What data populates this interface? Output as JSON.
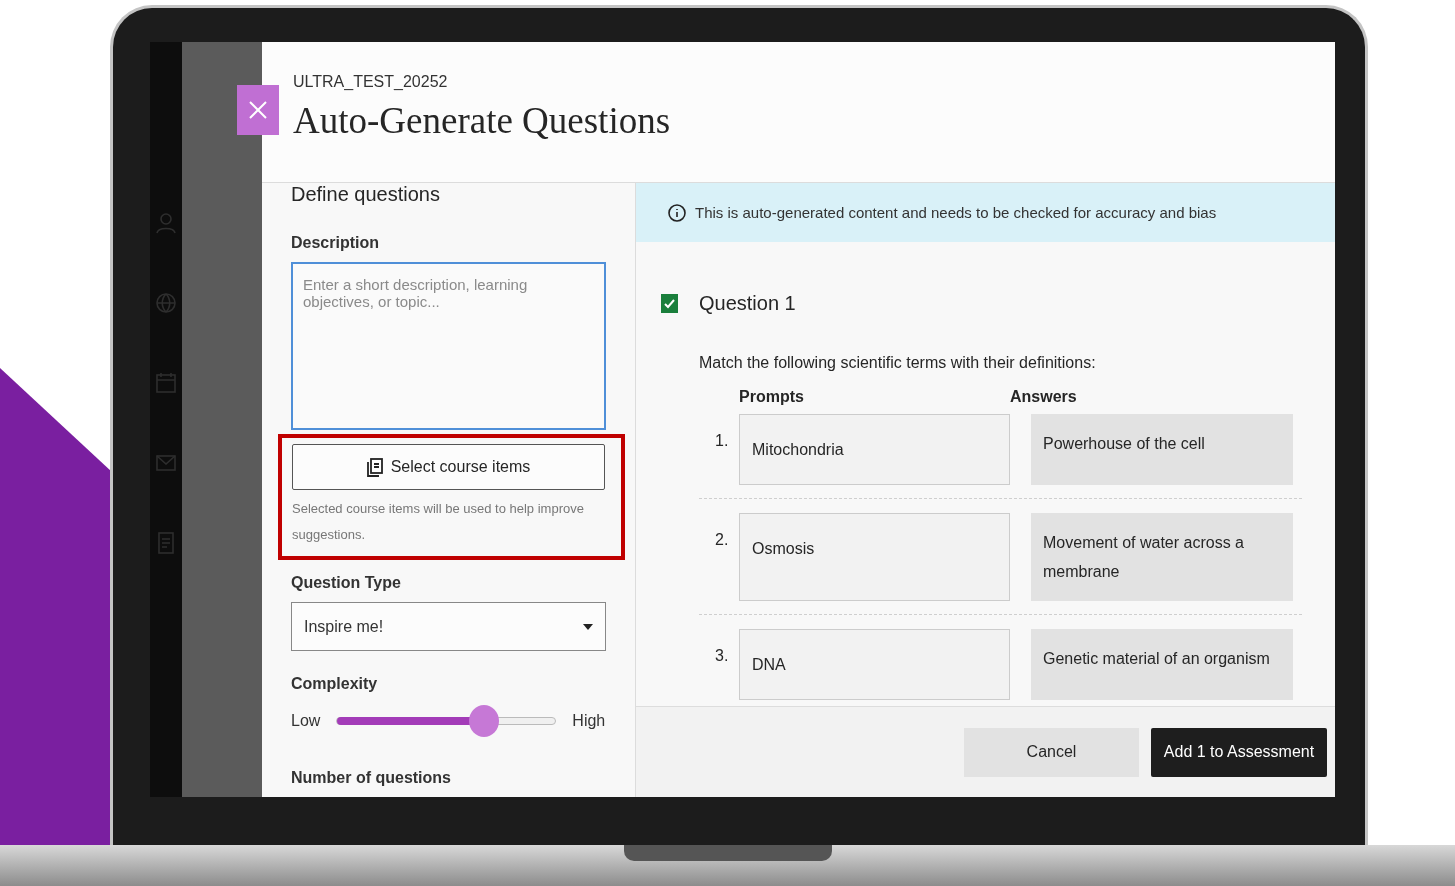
{
  "dialog": {
    "course_code": "ULTRA_TEST_20252",
    "title": "Auto-Generate Questions"
  },
  "define": {
    "heading": "Define questions",
    "description": {
      "label": "Description",
      "placeholder": "Enter a short description, learning objectives, or topic..."
    },
    "course_items": {
      "button": "Select course items",
      "help": "Selected course items will be used to help improve suggestions."
    },
    "question_type": {
      "label": "Question Type",
      "value": "Inspire me!"
    },
    "complexity": {
      "label": "Complexity",
      "low": "Low",
      "high": "High",
      "level": 0.67
    },
    "number_label": "Number of questions"
  },
  "notice": "This is auto-generated content and needs to be checked for accuracy and bias",
  "questions": [
    {
      "title": "Question 1",
      "checked": true,
      "instruction": "Match the following scientific terms with their definitions:",
      "prompts_heading": "Prompts",
      "answers_heading": "Answers",
      "pairs": [
        {
          "number": "1.",
          "prompt": "Mitochondria",
          "answer": "Powerhouse of the cell"
        },
        {
          "number": "2.",
          "prompt": "Osmosis",
          "answer": "Movement of water across a membrane"
        },
        {
          "number": "3.",
          "prompt": "DNA",
          "answer": "Genetic material of an organism"
        }
      ]
    }
  ],
  "actions": {
    "cancel": "Cancel",
    "add": "Add 1 to Assessment"
  }
}
